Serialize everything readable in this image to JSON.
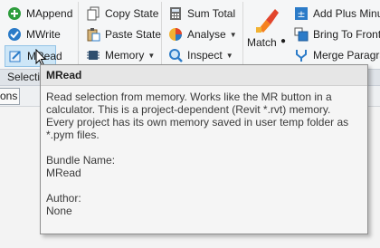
{
  "ribbon": {
    "mappend": "MAppend",
    "mwrite": "MWrite",
    "mread": "MRead",
    "copy_state": "Copy State",
    "paste_state": "Paste State",
    "memory": "Memory",
    "sum_total": "Sum Total",
    "analyse": "Analyse",
    "inspect": "Inspect",
    "match": "Match",
    "add_plus_minus": "Add Plus Minu",
    "bring_to_front": "Bring To Front",
    "merge_paragraph": "Merge Paragra"
  },
  "subbar": {
    "selection_label": "Selecti"
  },
  "options": {
    "label": "ons"
  },
  "tooltip": {
    "title": "MRead",
    "description": "Read selection from memory. Works like the MR button in a calculator. This is a project-dependent (Revit *.rvt) memory. Every project has its own memory saved in user temp folder as *.pym files.",
    "bundle_label": "Bundle Name:",
    "bundle_value": "MRead",
    "author_label": "Author:",
    "author_value": "None"
  },
  "colors": {
    "accent": "#2b7bc8",
    "tooltip_bg": "#f5f5f5",
    "highlight": "#cde6f7"
  }
}
